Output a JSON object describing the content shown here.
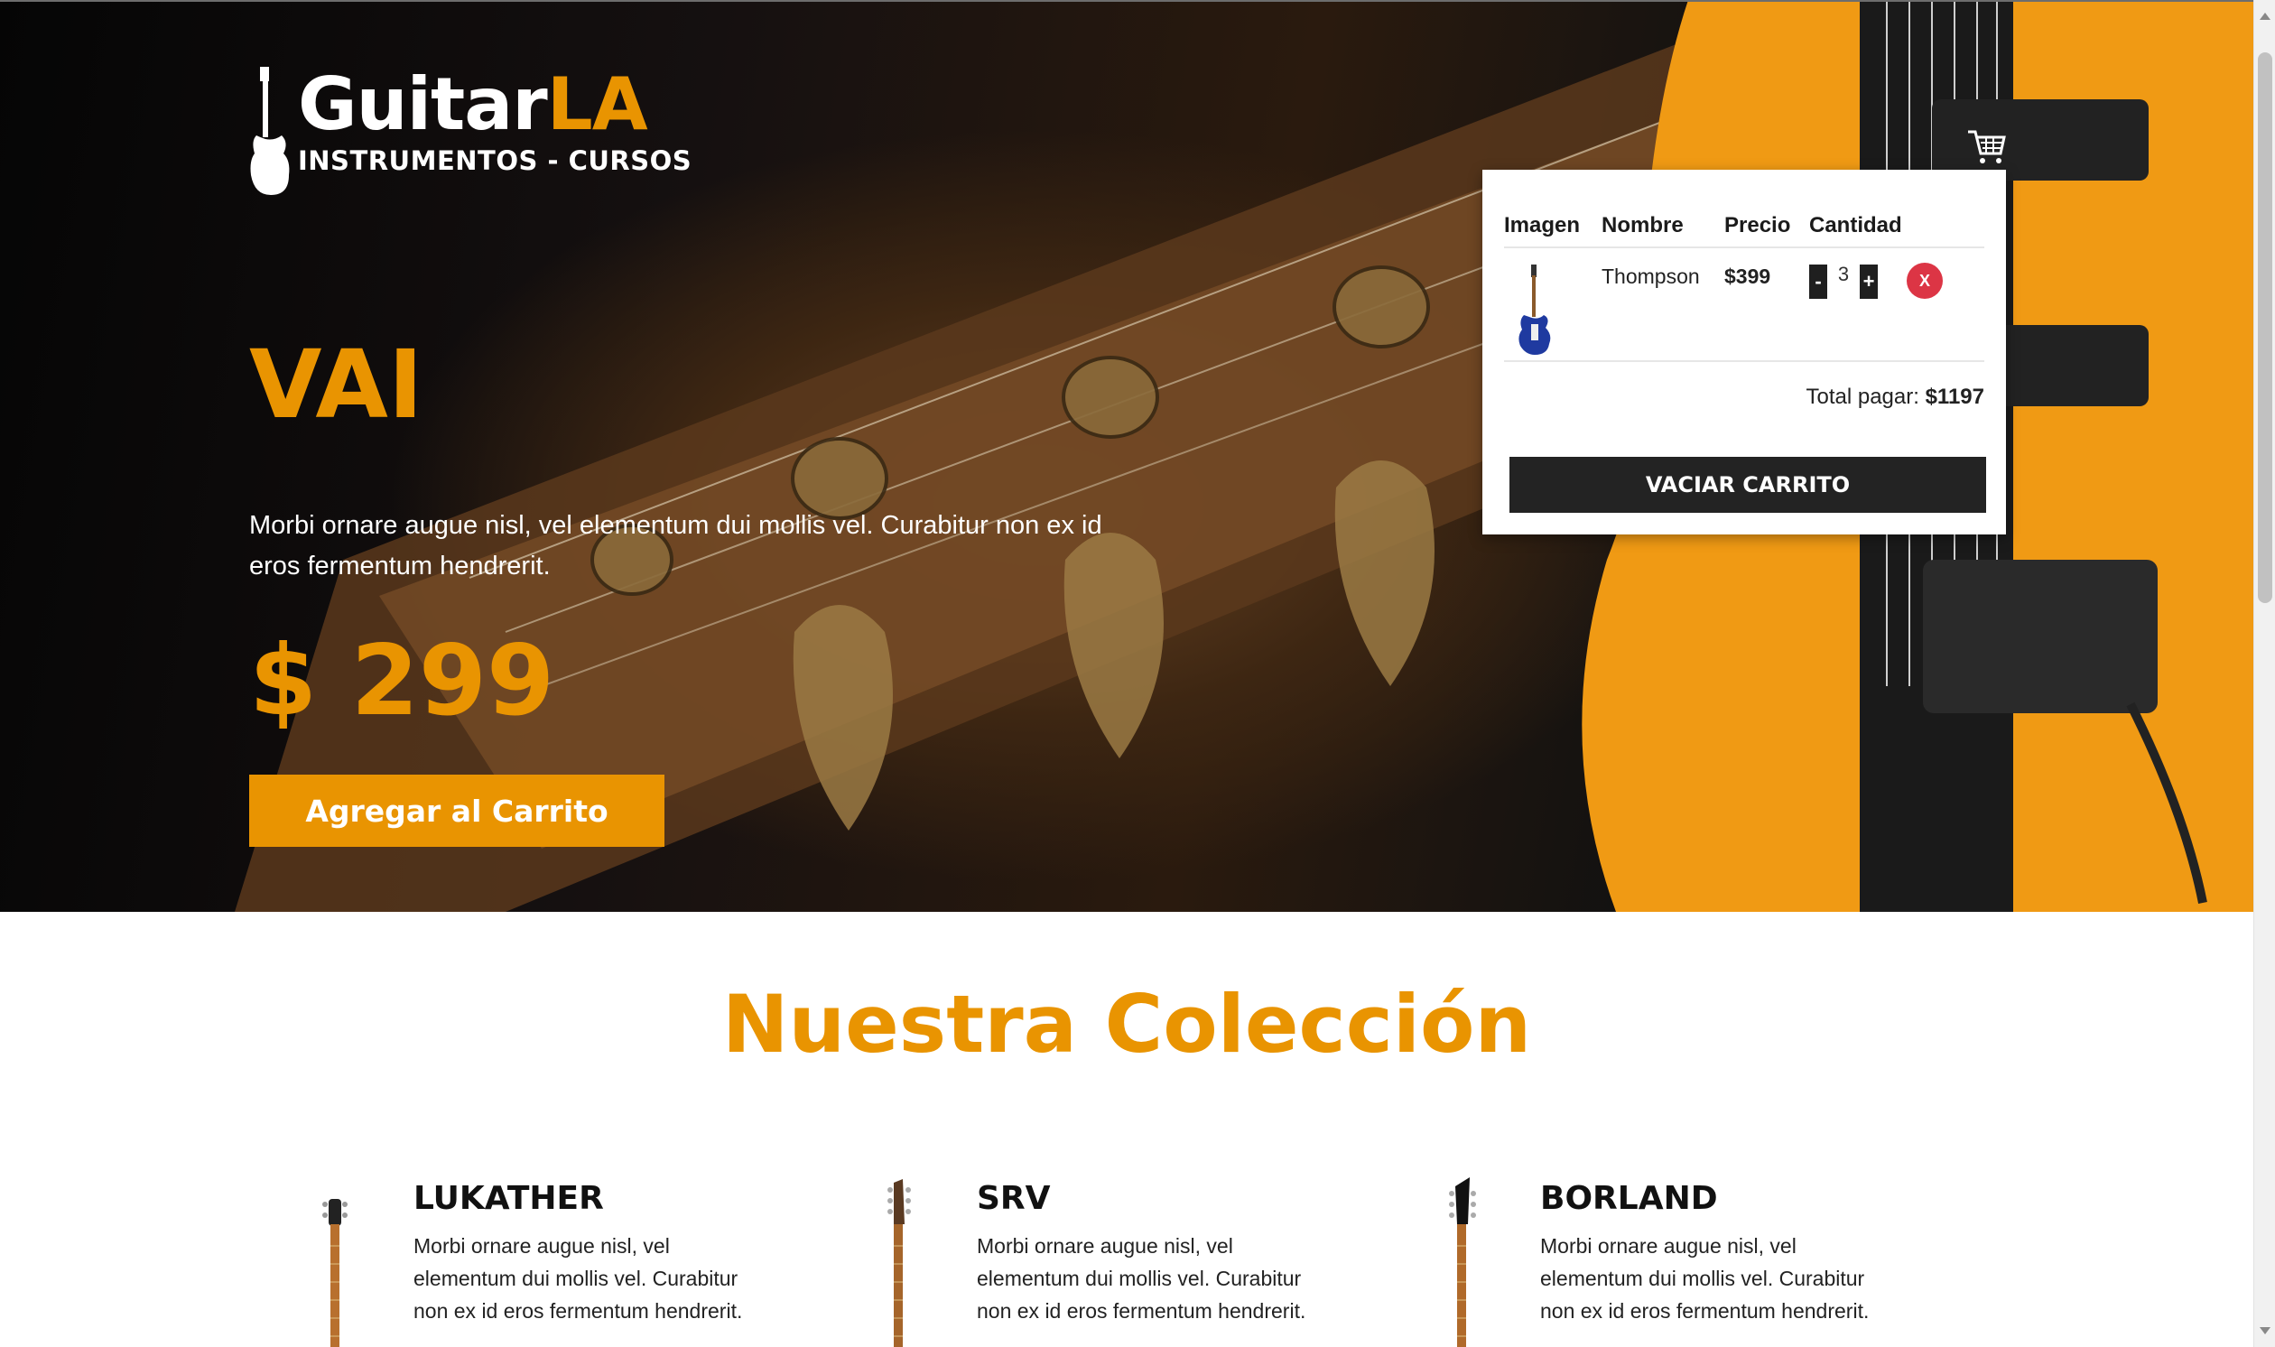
{
  "brand": {
    "name_part1": "Guitar",
    "name_part2": "LA",
    "tagline": "INSTRUMENTOS - CURSOS",
    "accent_color": "#e99401"
  },
  "hero": {
    "title": "VAI",
    "description": "Morbi ornare augue nisl, vel elementum dui mollis vel. Curabitur non ex id eros fermentum hendrerit.",
    "price": "$ 299",
    "add_button": "Agregar al Carrito"
  },
  "cart": {
    "icon": "shopping-cart-icon",
    "headers": [
      "Imagen",
      "Nombre",
      "Precio",
      "Cantidad"
    ],
    "items": [
      {
        "name": "Thompson",
        "price": "$399",
        "quantity": "3",
        "decrement": "-",
        "increment": "+",
        "remove": "X"
      }
    ],
    "total_label": "Total pagar:",
    "total_value": "$1197",
    "empty_button": "VACIAR CARRITO"
  },
  "collection": {
    "title": "Nuestra Colección",
    "products": [
      {
        "name": "LUKATHER",
        "description": "Morbi ornare augue nisl, vel elementum dui mollis vel. Curabitur non ex id eros fermentum hendrerit."
      },
      {
        "name": "SRV",
        "description": "Morbi ornare augue nisl, vel elementum dui mollis vel. Curabitur non ex id eros fermentum hendrerit."
      },
      {
        "name": "BORLAND",
        "description": "Morbi ornare augue nisl, vel elementum dui mollis vel. Curabitur non ex id eros fermentum hendrerit."
      }
    ]
  }
}
